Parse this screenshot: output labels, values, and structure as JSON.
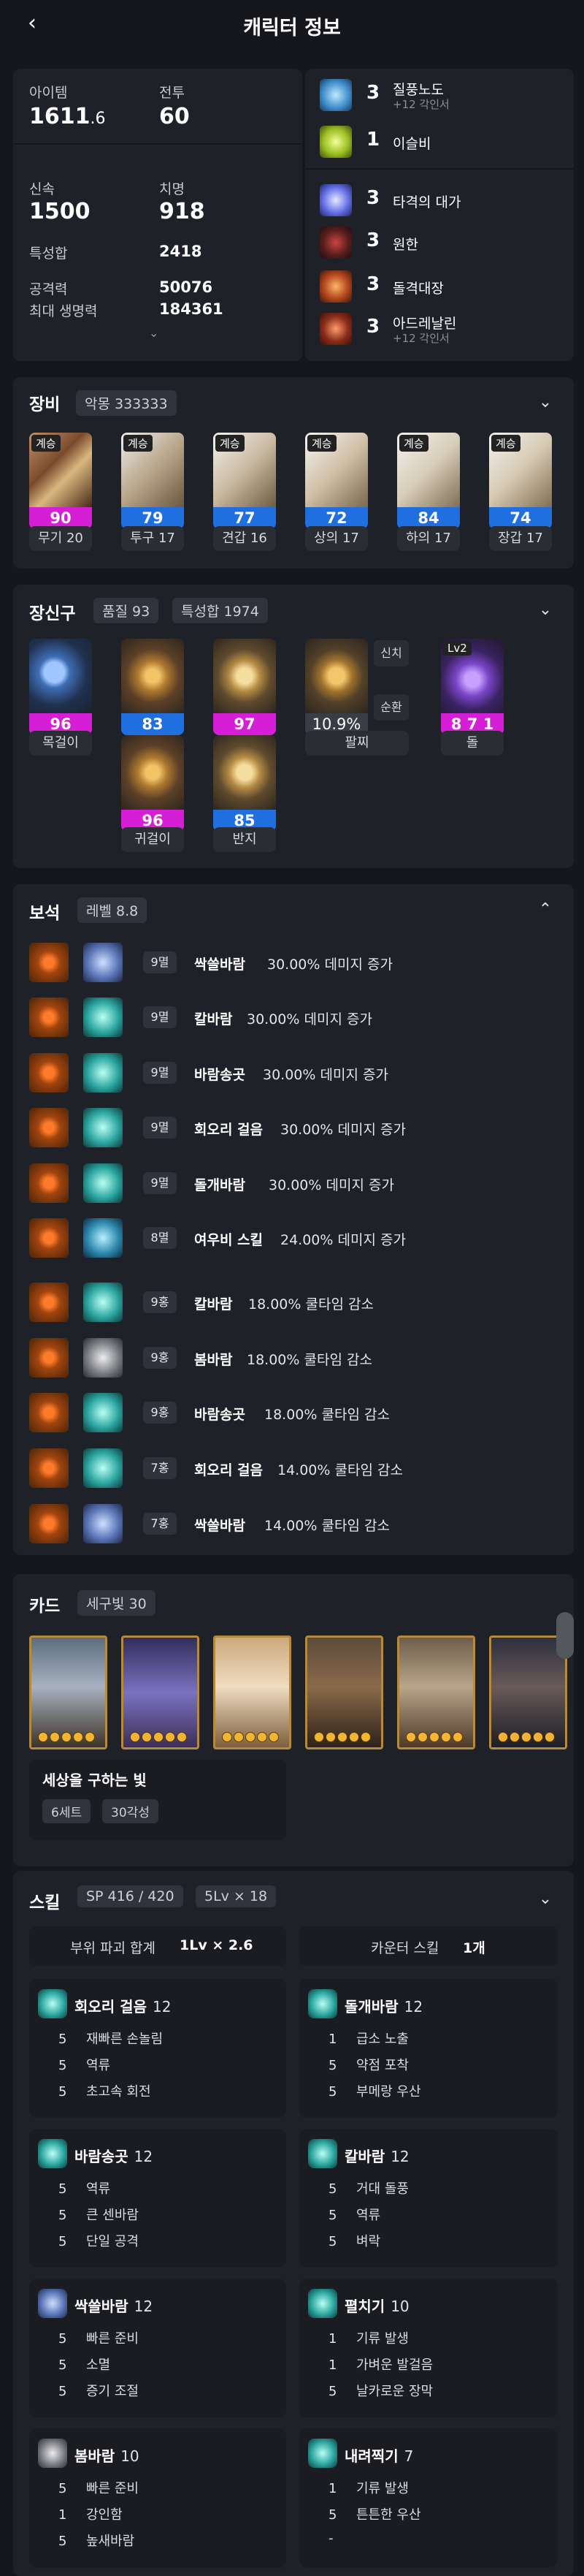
{
  "header": {
    "title": "캐릭터 정보",
    "back_icon": "chevron-left-icon"
  },
  "stats": {
    "item_label": "아이템",
    "item_value_main": "1611",
    "item_value_frac": ".6",
    "battle_label": "전투",
    "battle_value": "60",
    "swift_label": "신속",
    "swift_value": "1500",
    "crit_label": "치명",
    "crit_value": "918",
    "special_sum_label": "특성합",
    "special_sum_value": "2418",
    "attack_label": "공격력",
    "attack_value": "50076",
    "hp_label": "최대 생명력",
    "hp_value": "184361"
  },
  "engravings": [
    {
      "count": "3",
      "name": "질풍노도",
      "sub": "+12 각인서"
    },
    {
      "count": "1",
      "name": "이슬비",
      "sub": ""
    },
    {
      "count": "3",
      "name": "타격의 대가",
      "sub": ""
    },
    {
      "count": "3",
      "name": "원한",
      "sub": ""
    },
    {
      "count": "3",
      "name": "돌격대장",
      "sub": ""
    },
    {
      "count": "3",
      "name": "아드레날린",
      "sub": "+12 각인서"
    }
  ],
  "equipment": {
    "title": "장비",
    "badge": "악몽 333333",
    "items": [
      {
        "tag": "계승",
        "quality": "90",
        "label": "무기 20",
        "color": "#d61ed6"
      },
      {
        "tag": "계승",
        "quality": "79",
        "label": "투구 17",
        "color": "#1f6fe0"
      },
      {
        "tag": "계승",
        "quality": "77",
        "label": "견갑 16",
        "color": "#1f6fe0"
      },
      {
        "tag": "계승",
        "quality": "72",
        "label": "상의 17",
        "color": "#1f6fe0"
      },
      {
        "tag": "계승",
        "quality": "84",
        "label": "하의 17",
        "color": "#1f6fe0"
      },
      {
        "tag": "계승",
        "quality": "74",
        "label": "장갑 17",
        "color": "#1f6fe0"
      }
    ]
  },
  "accessories": {
    "title": "장신구",
    "quality_badge": "품질 93",
    "special_badge": "특성합 1974",
    "necklace": {
      "quality": "96",
      "label": "목걸이"
    },
    "earring1": {
      "quality": "83"
    },
    "earring2": {
      "quality": "97"
    },
    "earring3": {
      "quality": "96"
    },
    "ring1": {
      "quality": "85"
    },
    "earring_label": "귀걸이",
    "ring_label": "반지",
    "bracelet": {
      "value": "10.9%",
      "label": "팔찌",
      "tag1": "신치",
      "tag2": "순환"
    },
    "stone": {
      "tag": "Lv2",
      "value": "8 7 1",
      "label": "돌"
    }
  },
  "gems": {
    "title": "보석",
    "badge": "레벨 8.8",
    "rows": [
      {
        "level": "9멸",
        "skill": "싹쓸바람",
        "effect": "30.00% 데미지 증가"
      },
      {
        "level": "9멸",
        "skill": "칼바람",
        "effect": "30.00% 데미지 증가"
      },
      {
        "level": "9멸",
        "skill": "바람송곳",
        "effect": "30.00% 데미지 증가"
      },
      {
        "level": "9멸",
        "skill": "회오리 걸음",
        "effect": "30.00% 데미지 증가"
      },
      {
        "level": "9멸",
        "skill": "돌개바람",
        "effect": "30.00% 데미지 증가"
      },
      {
        "level": "8멸",
        "skill": "여우비 스킬",
        "effect": "24.00% 데미지 증가"
      },
      {
        "level": "9홍",
        "skill": "칼바람",
        "effect": "18.00% 쿨타임 감소"
      },
      {
        "level": "9홍",
        "skill": "봄바람",
        "effect": "18.00% 쿨타임 감소"
      },
      {
        "level": "9홍",
        "skill": "바람송곳",
        "effect": "18.00% 쿨타임 감소"
      },
      {
        "level": "7홍",
        "skill": "회오리 걸음",
        "effect": "14.00% 쿨타임 감소"
      },
      {
        "level": "7홍",
        "skill": "싹쓸바람",
        "effect": "14.00% 쿨타임 감소"
      }
    ]
  },
  "cards": {
    "title": "카드",
    "badge": "세구빛 30",
    "set_name": "세상을 구하는 빛",
    "set_count": "6세트",
    "awaken": "30각성"
  },
  "skills": {
    "title": "스킬",
    "sp": "SP 416 / 420",
    "lv": "5Lv × 18",
    "break_label": "부위 파괴 합계",
    "break_value": "1Lv × 2.6",
    "counter_label": "카운터 스킬",
    "counter_value": "1개",
    "list": [
      {
        "name": "회오리 걸음",
        "level": "12",
        "rows": [
          [
            "5",
            "재빠른 손놀림"
          ],
          [
            "5",
            "역류"
          ],
          [
            "5",
            "초고속 회전"
          ]
        ]
      },
      {
        "name": "돌개바람",
        "level": "12",
        "rows": [
          [
            "1",
            "급소 노출"
          ],
          [
            "5",
            "약점 포착"
          ],
          [
            "5",
            "부메랑 우산"
          ]
        ]
      },
      {
        "name": "바람송곳",
        "level": "12",
        "rows": [
          [
            "5",
            "역류"
          ],
          [
            "5",
            "큰 센바람"
          ],
          [
            "5",
            "단일 공격"
          ]
        ]
      },
      {
        "name": "칼바람",
        "level": "12",
        "rows": [
          [
            "5",
            "거대 돌풍"
          ],
          [
            "5",
            "역류"
          ],
          [
            "5",
            "벼락"
          ]
        ]
      },
      {
        "name": "싹쓸바람",
        "level": "12",
        "rows": [
          [
            "5",
            "빠른 준비"
          ],
          [
            "5",
            "소멸"
          ],
          [
            "5",
            "증기 조절"
          ]
        ]
      },
      {
        "name": "펼치기",
        "level": "10",
        "rows": [
          [
            "1",
            "기류 발생"
          ],
          [
            "1",
            "가벼운 발걸음"
          ],
          [
            "5",
            "날카로운 장막"
          ]
        ]
      },
      {
        "name": "봄바람",
        "level": "10",
        "rows": [
          [
            "5",
            "빠른 준비"
          ],
          [
            "1",
            "강인함"
          ],
          [
            "5",
            "높새바람"
          ]
        ]
      },
      {
        "name": "내려찍기",
        "level": "7",
        "rows": [
          [
            "1",
            "기류 발생"
          ],
          [
            "5",
            "튼튼한 우산"
          ],
          [
            "-",
            ""
          ]
        ]
      }
    ]
  },
  "colors": {
    "bg": "#16171c",
    "card": "#1f2128",
    "quality_purple": "#d61ed6",
    "quality_blue": "#1f6fe0"
  }
}
